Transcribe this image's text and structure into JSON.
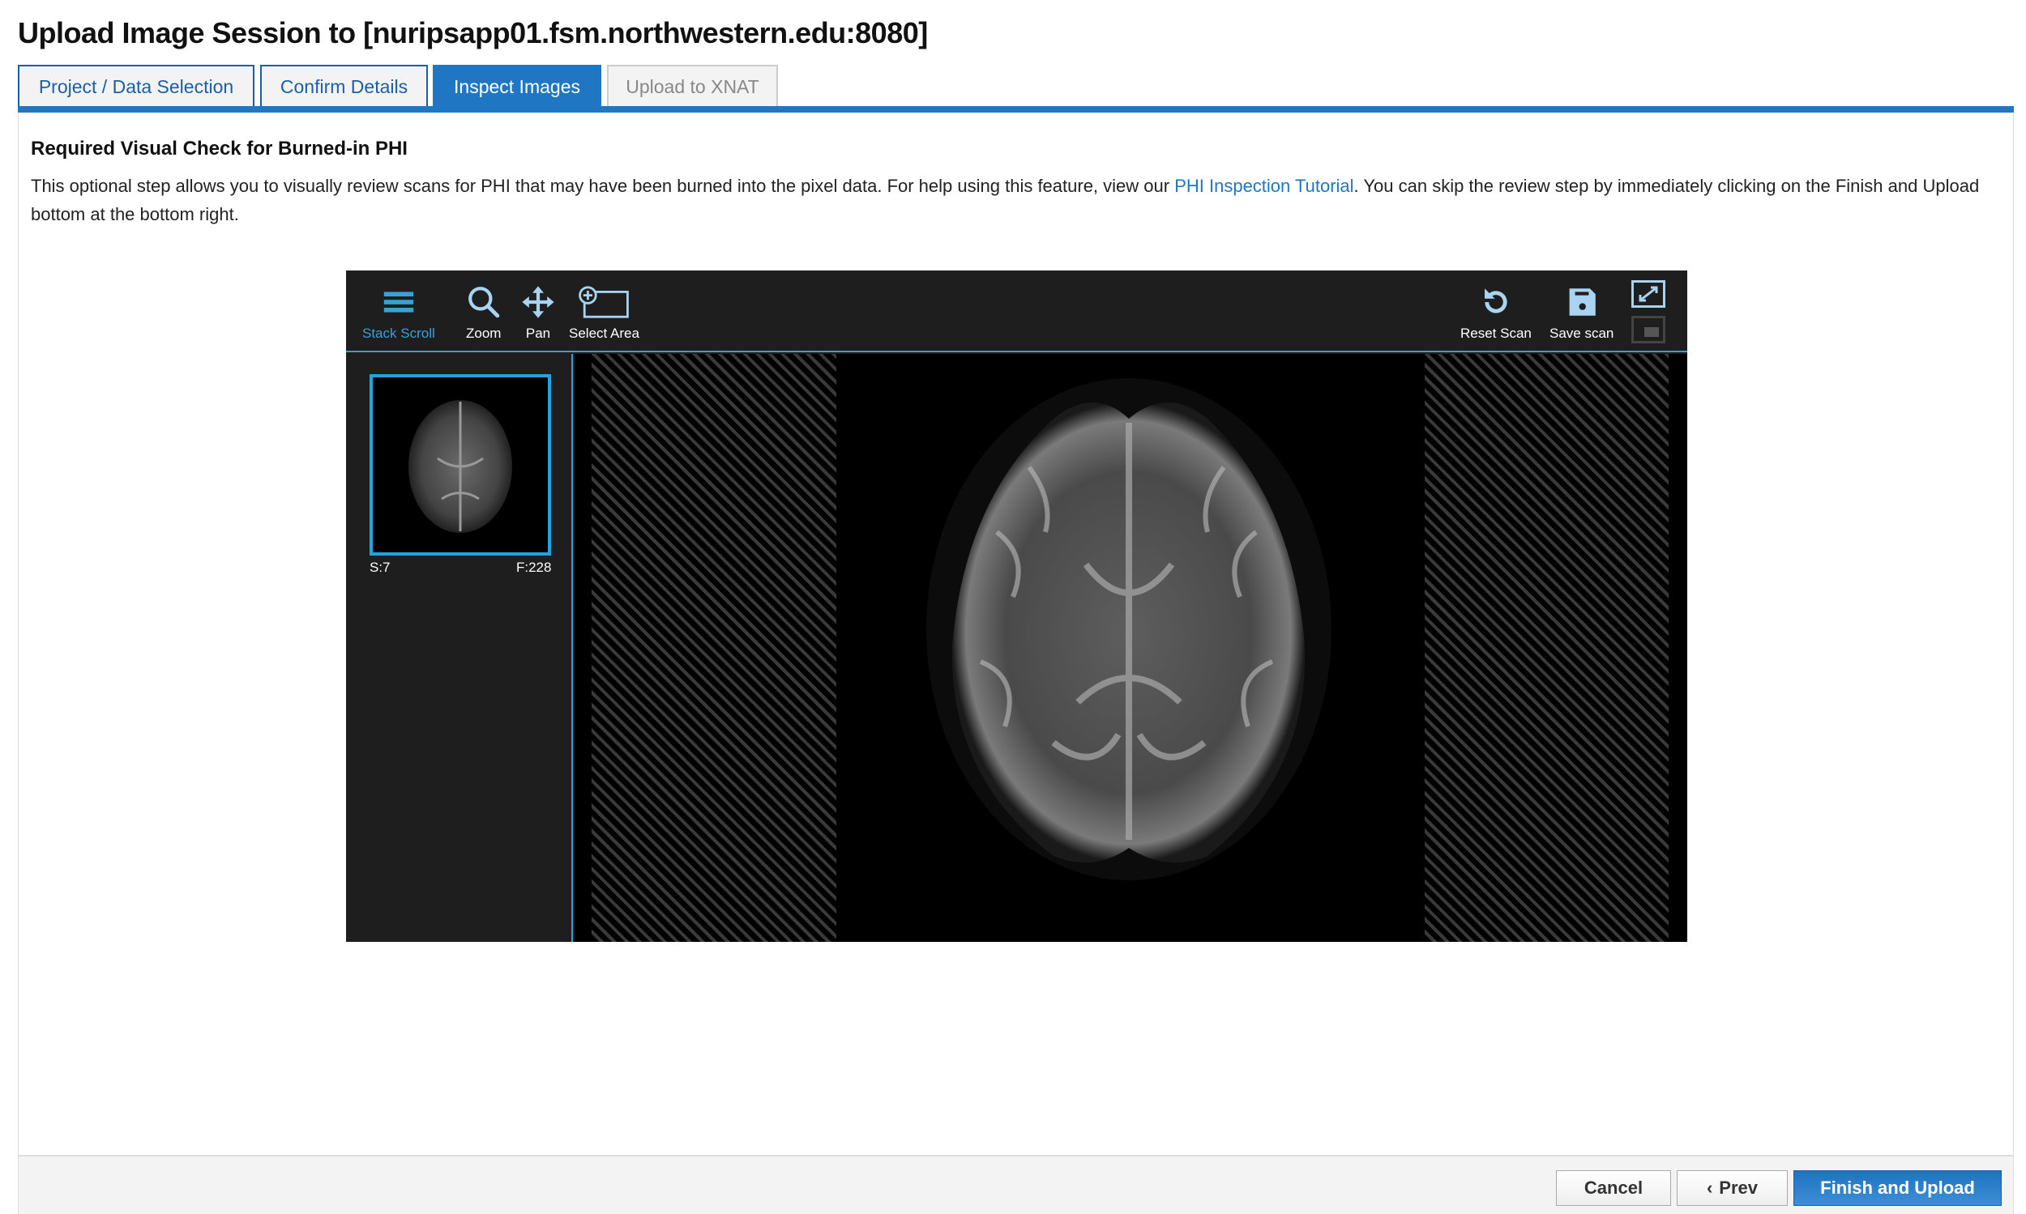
{
  "title": "Upload Image Session to [nuripsapp01.fsm.northwestern.edu:8080]",
  "tabs": [
    {
      "label": "Project / Data Selection",
      "state": "done"
    },
    {
      "label": "Confirm Details",
      "state": "done"
    },
    {
      "label": "Inspect Images",
      "state": "active"
    },
    {
      "label": "Upload to XNAT",
      "state": "disabled"
    }
  ],
  "section": {
    "heading": "Required Visual Check for Burned-in PHI",
    "text_before": "This optional step allows you to visually review scans for PHI that may have been burned into the pixel data. For help using this feature, view our ",
    "link": "PHI Inspection Tutorial",
    "text_after": ". You can skip the review step by immediately clicking on the Finish and Upload bottom at the bottom right."
  },
  "viewer": {
    "tools": [
      {
        "label": "Stack Scroll",
        "icon": "bars-icon",
        "active": true
      },
      {
        "label": "Zoom",
        "icon": "magnifier-icon"
      },
      {
        "label": "Pan",
        "icon": "move-arrows-icon"
      },
      {
        "label": "Select Area",
        "icon": "select-area-icon"
      },
      {
        "label": "Reset Scan",
        "icon": "undo-icon"
      },
      {
        "label": "Save scan",
        "icon": "floppy-disk-icon"
      }
    ],
    "thumbnail": {
      "series": "S:7",
      "frames": "F:228"
    },
    "accent": "#22a3dd"
  },
  "footer": {
    "cancel": "Cancel",
    "prev": "Prev",
    "finish": "Finish and Upload"
  },
  "colors": {
    "primary": "#1f77c4",
    "viewer_bg": "#1e1e1e"
  }
}
